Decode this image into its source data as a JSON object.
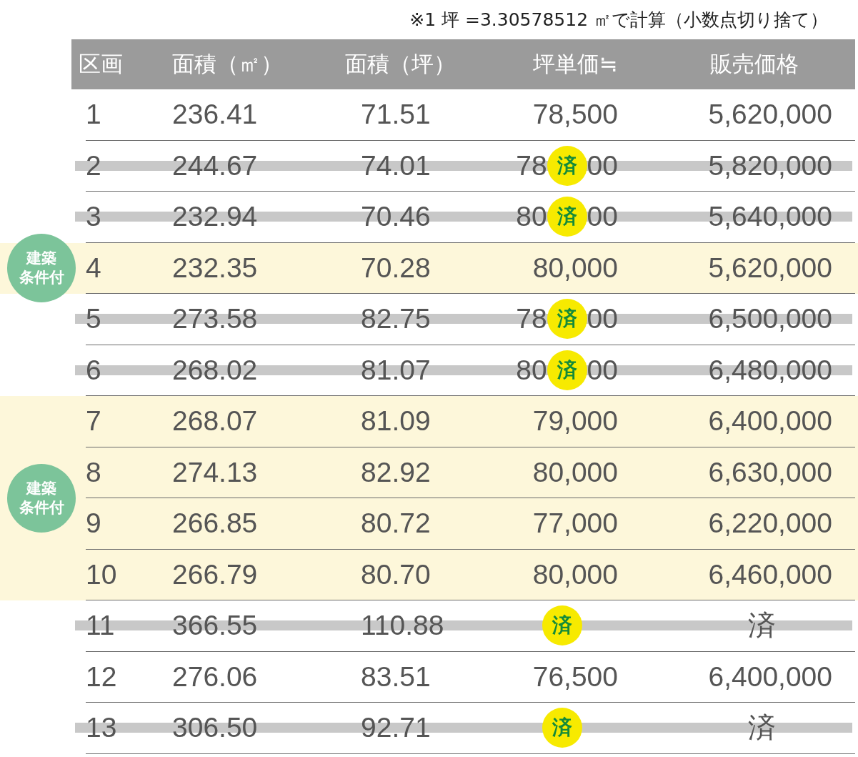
{
  "note": "※1 坪 =3.30578512 ㎡で計算（小数点切り捨て）",
  "columns": [
    "区画",
    "面積（㎡）",
    "面積（坪）",
    "坪単価≒",
    "販売価格"
  ],
  "groups": [
    {
      "highlighted": false,
      "rows": [
        {
          "lot": "1",
          "area_m2": "236.41",
          "area_tsubo": "71.51",
          "tsubo_price": "78,500",
          "price": "5,620,000",
          "sold": false
        },
        {
          "lot": "2",
          "area_m2": "244.67",
          "area_tsubo": "74.01",
          "tsubo_price_parts": [
            "78",
            "00"
          ],
          "price": "5,820,000",
          "sold": true,
          "sold_mark": "済"
        },
        {
          "lot": "3",
          "area_m2": "232.94",
          "area_tsubo": "70.46",
          "tsubo_price_parts": [
            "80",
            "00"
          ],
          "price": "5,640,000",
          "sold": true,
          "sold_mark": "済"
        }
      ]
    },
    {
      "highlighted": true,
      "badge": [
        "建築",
        "条件付"
      ],
      "rows": [
        {
          "lot": "4",
          "area_m2": "232.35",
          "area_tsubo": "70.28",
          "tsubo_price": "80,000",
          "price": "5,620,000",
          "sold": false
        }
      ]
    },
    {
      "highlighted": false,
      "rows": [
        {
          "lot": "5",
          "area_m2": "273.58",
          "area_tsubo": "82.75",
          "tsubo_price_parts": [
            "78",
            "00"
          ],
          "price": "6,500,000",
          "sold": true,
          "sold_mark": "済"
        },
        {
          "lot": "6",
          "area_m2": "268.02",
          "area_tsubo": "81.07",
          "tsubo_price_parts": [
            "80",
            "00"
          ],
          "price": "6,480,000",
          "sold": true,
          "sold_mark": "済"
        }
      ]
    },
    {
      "highlighted": true,
      "badge": [
        "建築",
        "条件付"
      ],
      "rows": [
        {
          "lot": "7",
          "area_m2": "268.07",
          "area_tsubo": "81.09",
          "tsubo_price": "79,000",
          "price": "6,400,000",
          "sold": false
        },
        {
          "lot": "8",
          "area_m2": "274.13",
          "area_tsubo": "82.92",
          "tsubo_price": "80,000",
          "price": "6,630,000",
          "sold": false
        },
        {
          "lot": "9",
          "area_m2": "266.85",
          "area_tsubo": "80.72",
          "tsubo_price": "77,000",
          "price": "6,220,000",
          "sold": false
        },
        {
          "lot": "10",
          "area_m2": "266.79",
          "area_tsubo": "80.70",
          "tsubo_price": "80,000",
          "price": "6,460,000",
          "sold": false
        }
      ]
    },
    {
      "highlighted": false,
      "rows": [
        {
          "lot": "11",
          "area_m2": "366.55",
          "area_tsubo": "110.88",
          "price": "済",
          "sold": true,
          "sold_mark": "済"
        },
        {
          "lot": "12",
          "area_m2": "276.06",
          "area_tsubo": "83.51",
          "tsubo_price": "76,500",
          "price": "6,400,000",
          "sold": false
        },
        {
          "lot": "13",
          "area_m2": "306.50",
          "area_tsubo": "92.71",
          "price": "済",
          "sold": true,
          "sold_mark": "済"
        }
      ]
    }
  ]
}
